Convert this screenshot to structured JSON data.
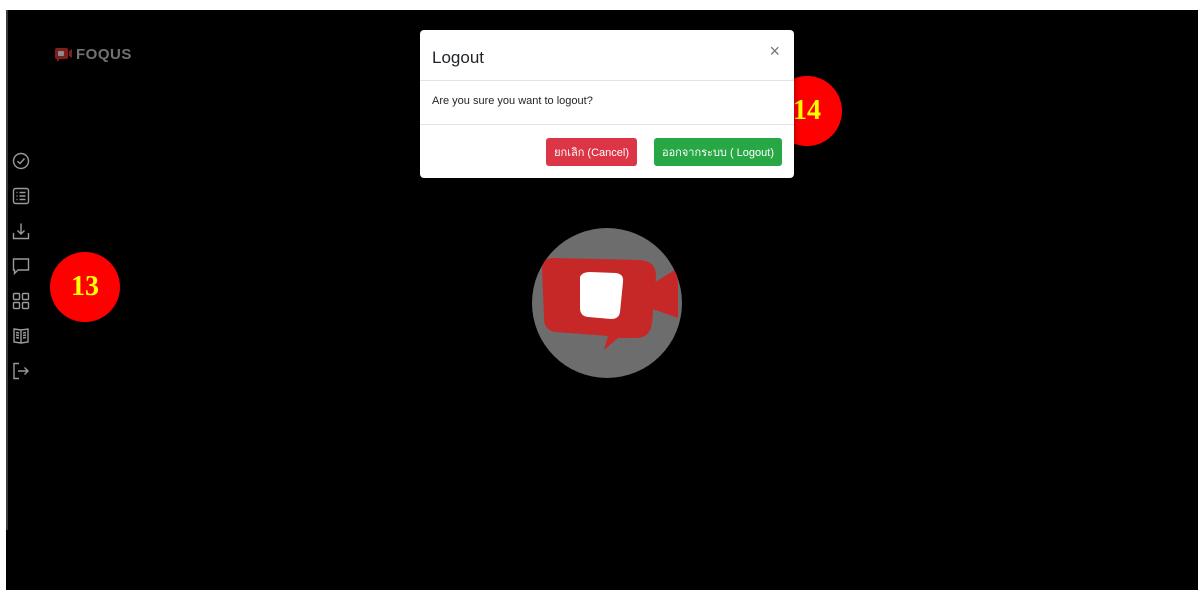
{
  "brand": {
    "logo_text": "FOQUS",
    "accent_color": "#e53935"
  },
  "sidebar": {
    "items": [
      {
        "icon": "check-circle-icon"
      },
      {
        "icon": "list-icon"
      },
      {
        "icon": "download-icon"
      },
      {
        "icon": "chat-icon"
      },
      {
        "icon": "grid-icon"
      },
      {
        "icon": "book-icon"
      },
      {
        "icon": "logout-icon"
      }
    ]
  },
  "modal": {
    "title": "Logout",
    "close_label": "×",
    "message": "Are you sure you want to logout?",
    "cancel_label": "ยกเลิก (Cancel)",
    "logout_label": "ออกจากระบบ ( Logout)",
    "cancel_color": "#dc3545",
    "logout_color": "#28a745"
  },
  "annotations": {
    "badge_13": "13",
    "badge_14": "14"
  }
}
